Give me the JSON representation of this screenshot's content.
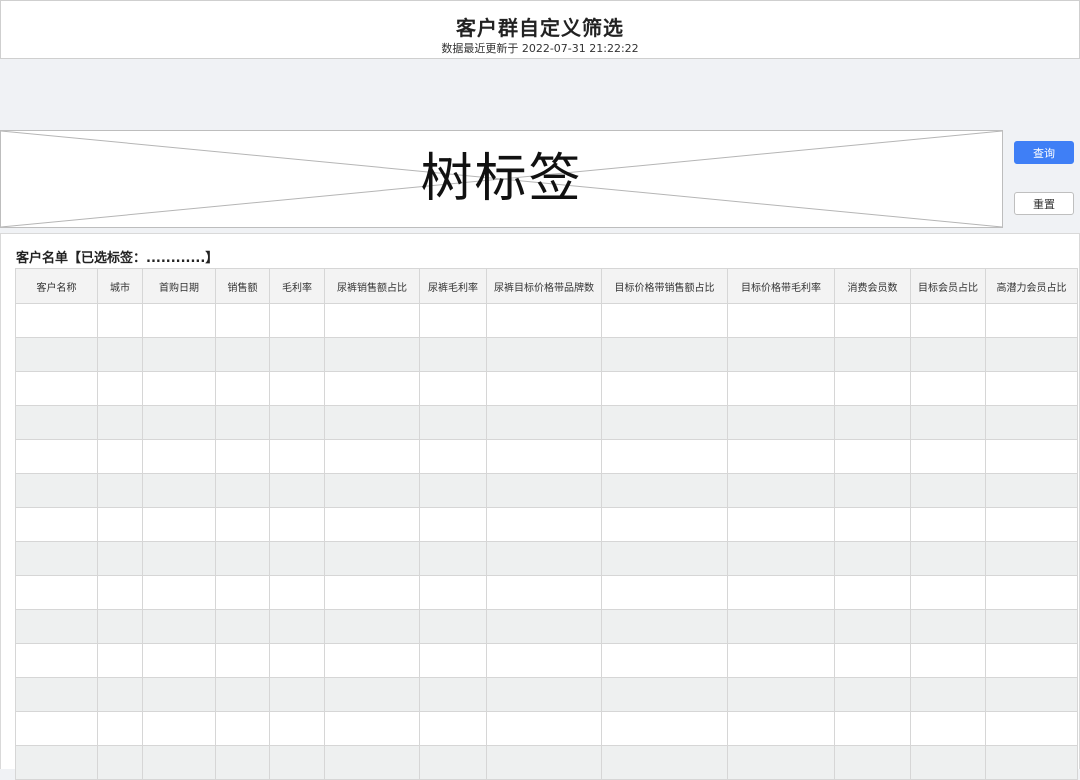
{
  "header": {
    "title": "客户群自定义筛选",
    "update_prefix": "数据最近更新于",
    "update_time": "2022-07-31 21:22:22"
  },
  "tree_tag": {
    "label": "树标签"
  },
  "actions": {
    "query_label": "查询",
    "reset_label": "重置"
  },
  "customer_list": {
    "title": "客户名单【已选标签：............】",
    "columns": [
      "客户名称",
      "城市",
      "首购日期",
      "销售额",
      "毛利率",
      "尿裤销售额占比",
      "尿裤毛利率",
      "尿裤目标价格带品牌数",
      "目标价格带销售额占比",
      "目标价格带毛利率",
      "消费会员数",
      "目标会员占比",
      "高潜力会员占比"
    ],
    "rows": []
  }
}
